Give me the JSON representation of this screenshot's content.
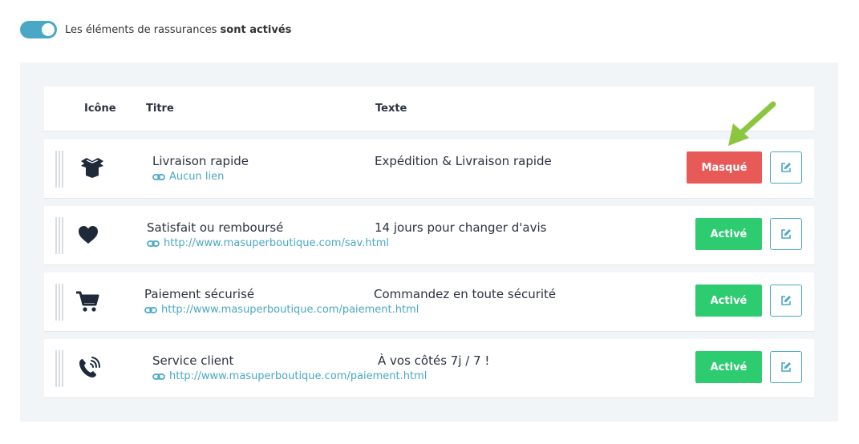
{
  "header": {
    "toggle_state": "on",
    "label_prefix": "Les éléments de rassurances",
    "label_status": "sont activés"
  },
  "table": {
    "columns": {
      "icon": "Icône",
      "title": "Titre",
      "text": "Texte"
    }
  },
  "rows": [
    {
      "icon": "box-icon",
      "title": "Livraison rapide",
      "link": "Aucun lien",
      "text": "Expédition & Livraison rapide",
      "status": "Masqué",
      "status_color": "#e85a58"
    },
    {
      "icon": "heart-icon",
      "title": "Satisfait ou remboursé",
      "link": "http://www.masuperboutique.com/sav.html",
      "text": "14 jours pour changer d'avis",
      "status": "Activé",
      "status_color": "#2dcc70"
    },
    {
      "icon": "cart-icon",
      "title": "Paiement sécurisé",
      "link": "http://www.masuperboutique.com/paiement.html",
      "text": "Commandez en toute sécurité",
      "status": "Activé",
      "status_color": "#2dcc70"
    },
    {
      "icon": "phone-icon",
      "title": "Service client",
      "link": "http://www.masuperboutique.com/paiement.html",
      "text": "À vos côtés 7j / 7 !",
      "status": "Activé",
      "status_color": "#2dcc70"
    }
  ],
  "colors": {
    "accent": "#4aa8c6",
    "active": "#2dcc70",
    "hidden": "#e85a58",
    "annotation_arrow": "#8cc63f"
  }
}
